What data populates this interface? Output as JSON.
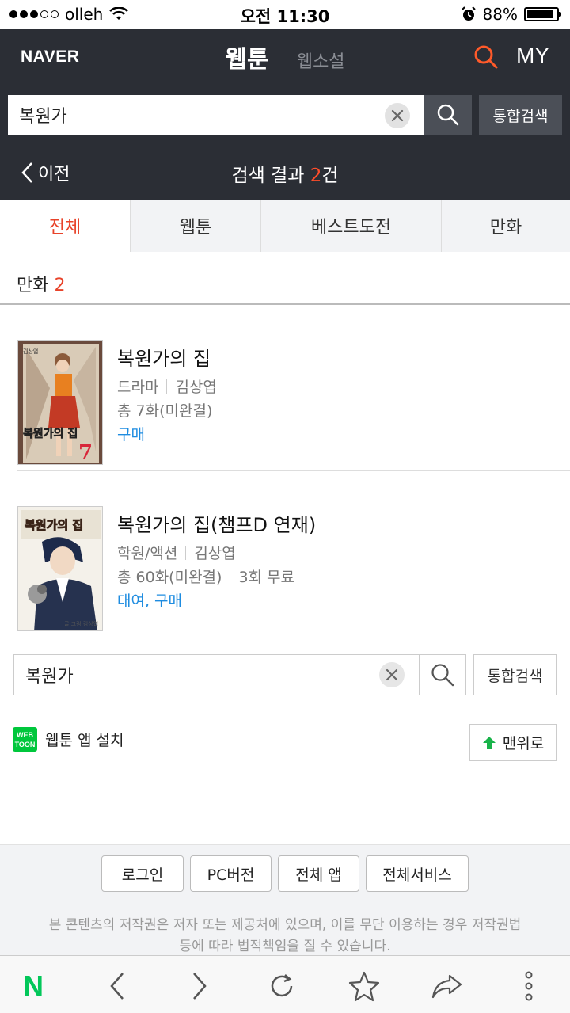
{
  "status_bar": {
    "carrier": "olleh",
    "time": "오전 11:30",
    "battery_percent": "88%",
    "battery_level": 0.88,
    "signal_bars": 3
  },
  "header": {
    "logo": "NAVER",
    "tab_active": "웹툰",
    "tab_inactive": "웹소설",
    "my_label": "MY"
  },
  "search": {
    "value": "복원가",
    "unified_label": "통합검색"
  },
  "result_bar": {
    "back_label": "이전",
    "title_prefix": "검색 결과 ",
    "count": "2",
    "title_suffix": "건"
  },
  "category_tabs": [
    {
      "label": "전체",
      "active": true
    },
    {
      "label": "웹툰",
      "active": false
    },
    {
      "label": "베스트도전",
      "active": false
    },
    {
      "label": "만화",
      "active": false
    }
  ],
  "section": {
    "label": "만화",
    "count": "2"
  },
  "items": [
    {
      "title": "복원가의 집",
      "genre": "드라마",
      "author": "김상엽",
      "episodes": "총 7화(미완결)",
      "free": "",
      "action": "구매",
      "cover_title": "복원가의 집",
      "cover_author": "김상엽",
      "cover_number": "7"
    },
    {
      "title": "복원가의 집(챔프D 연재)",
      "genre": "학원/액션",
      "author": "김상엽",
      "episodes": "총 60화(미완결)",
      "free": "3회 무료",
      "action": "대여, 구매",
      "cover_title": "복원가의 집",
      "cover_author": "글·그림 김상엽"
    }
  ],
  "bottom_search": {
    "value": "복원가",
    "unified_label": "통합검색"
  },
  "app_install": {
    "logo_text": "WEB TOON",
    "label": "웹툰 앱 설치"
  },
  "top_button": {
    "label": "맨위로"
  },
  "footer": {
    "buttons": [
      "로그인",
      "PC버전",
      "전체 앱",
      "전체서비스"
    ],
    "copyright_line1": "본 콘텐츠의 저작권은 저자 또는 제공처에 있으며, 이를 무단 이용하는 경우 저작권법",
    "copyright_line2": "등에 따라 법적책임을 질 수 있습니다."
  },
  "browser_bar": {
    "logo": "N"
  },
  "colors": {
    "header_bg": "#2b2e35",
    "accent": "#e8432a",
    "link": "#1e8ce0",
    "naver_green": "#03c75a"
  }
}
